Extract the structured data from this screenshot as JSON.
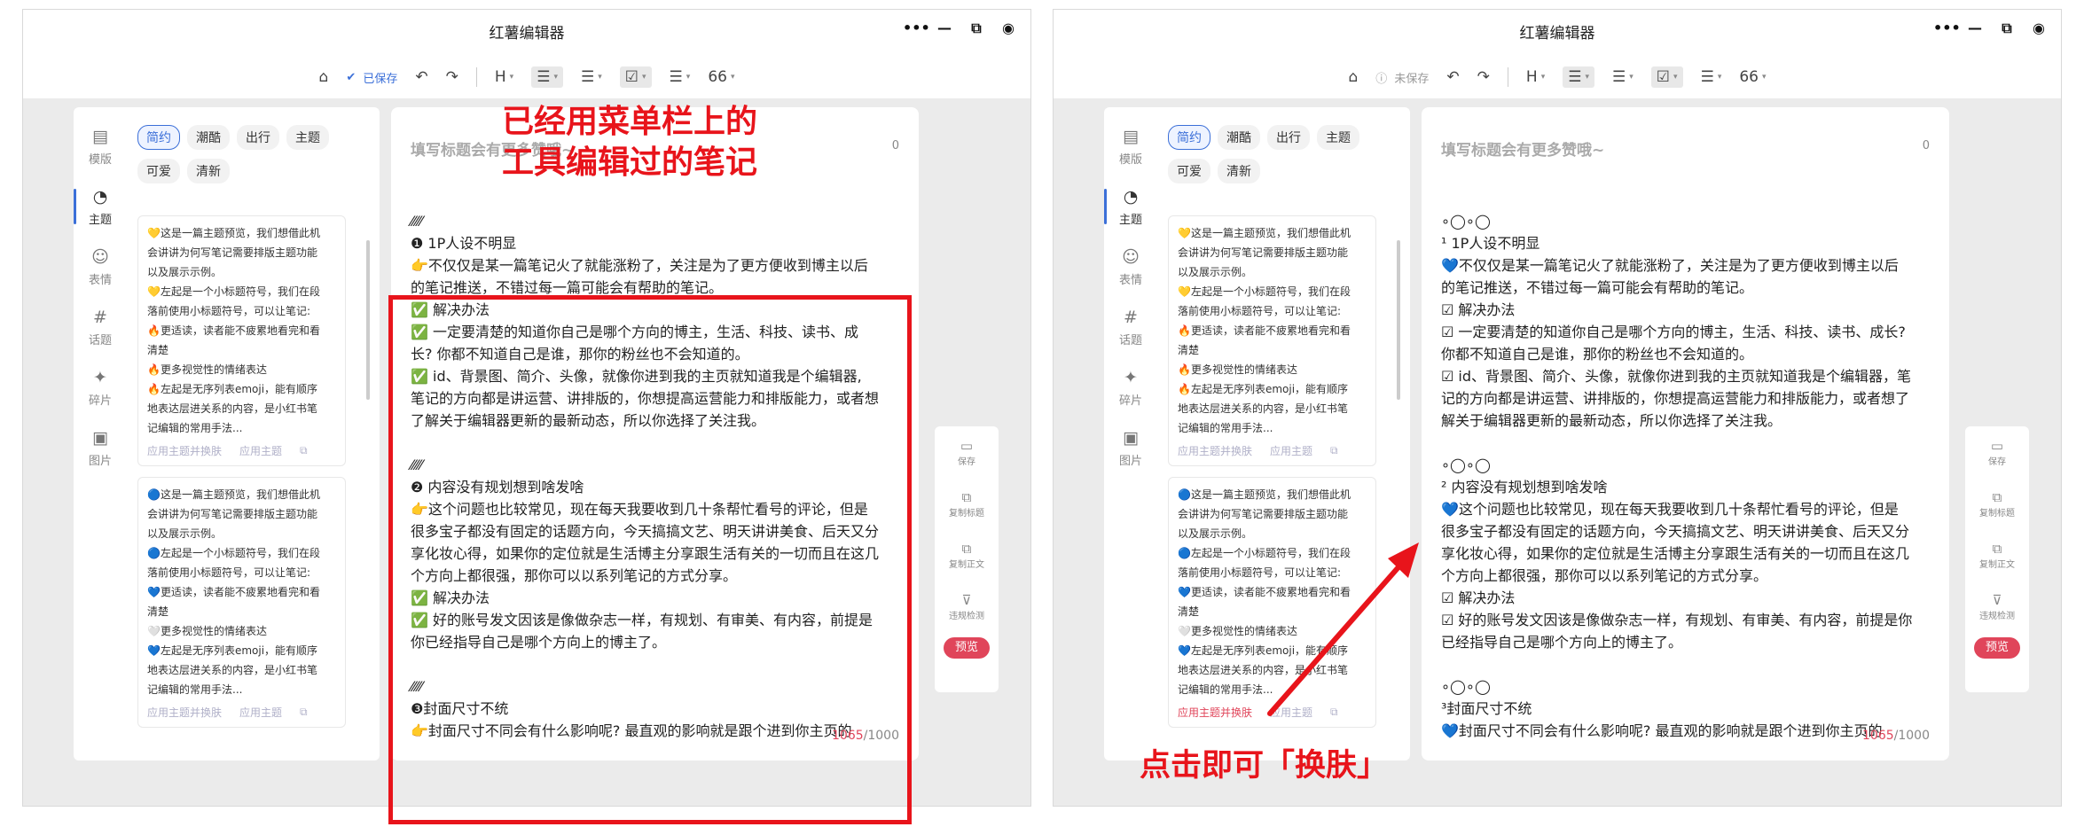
{
  "app": {
    "title": "红薯编辑器"
  },
  "toolbar": {
    "saved_label": "已保存",
    "unsaved_label": "未保存",
    "heading": "H",
    "list_ordered": "☰",
    "list_bullet": "☰",
    "checkbox": "☑",
    "align": "☰",
    "quote": "66"
  },
  "rail": [
    {
      "label": "模版",
      "icon": "template-icon"
    },
    {
      "label": "主题",
      "icon": "palette-icon"
    },
    {
      "label": "表情",
      "icon": "emoji-icon"
    },
    {
      "label": "话题",
      "icon": "hashtag-icon"
    },
    {
      "label": "碎片",
      "icon": "puzzle-icon"
    },
    {
      "label": "图片",
      "icon": "image-icon"
    }
  ],
  "theme_tags": [
    "简约",
    "潮酷",
    "出行",
    "主题",
    "可爱",
    "清新"
  ],
  "theme_cards": [
    {
      "lines": [
        "💛这是一篇主题预览，我们想借此机",
        "会讲讲为何写笔记需要排版主题功能",
        "以及展示示例。",
        "💛左起是一个小标题符号，我们在段",
        "落前使用小标题符号，可以让笔记:",
        "🔥更适读，读者能不疲累地看完和看",
        "清楚",
        "🔥更多视觉性的情绪表达",
        "🔥左起是无序列表emoji，能有顺序",
        "地表达层进关系的内容，是小红书笔",
        "记编辑的常用手法..."
      ],
      "apply_label": "应用主题并换肤",
      "theme_label": "应用主题"
    },
    {
      "lines": [
        "🔵这是一篇主题预览，我们想借此机",
        "会讲讲为何写笔记需要排版主题功能",
        "以及展示示例。",
        "🔵左起是一个小标题符号，我们在段",
        "落前使用小标题符号，可以让笔记:",
        "💙更适读，读者能不疲累地看完和看",
        "清楚",
        "🤍更多视觉性的情绪表达",
        "💙左起是无序列表emoji，能有顺序",
        "地表达层进关系的内容，是小红书笔",
        "记编辑的常用手法..."
      ],
      "apply_label": "应用主题并换肤",
      "theme_label": "应用主题"
    }
  ],
  "editor": {
    "title_placeholder": "填写标题会有更多赞哦~",
    "title_count": "0",
    "count_current": "1065",
    "count_max": "/1000"
  },
  "left_note": {
    "sections": [
      {
        "marker": "⁄⁄⁄⁄⁄",
        "lines": [
          "❶ 1P人设不明显",
          "👉不仅仅是某一篇笔记火了就能涨粉了，关注是为了更方便收到博主以后",
          "的笔记推送，不错过每一篇可能会有帮助的笔记。",
          "✅ 解决办法",
          "✅ 一定要清楚的知道你自己是哪个方向的博主，生活、科技、读书、成",
          "长? 你都不知道自己是谁，那你的粉丝也不会知道的。",
          "✅ id、背景图、简介、头像，就像你进到我的主页就知道我是个编辑器,",
          "笔记的方向都是讲运营、讲排版的，你想提高运营能力和排版能力，或者想",
          "了解关于编辑器更新的最新动态，所以你选择了关注我。"
        ]
      },
      {
        "marker": "⁄⁄⁄⁄⁄",
        "lines": [
          "❷ 内容没有规划想到啥发啥",
          "👉这个问题也比较常见，现在每天我要收到几十条帮忙看号的评论，但是",
          "很多宝子都没有固定的话题方向，今天搞搞文艺、明天讲讲美食、后天又分",
          "享化妆心得，如果你的定位就是生活博主分享跟生活有关的一切而且在这几",
          "个方向上都很强，那你可以以系列笔记的方式分享。",
          "✅ 解决办法",
          "✅ 好的账号发文因该是像做杂志一样，有规划、有审美、有内容，前提是",
          "你已经指导自己是哪个方向上的博主了。"
        ]
      },
      {
        "marker": "⁄⁄⁄⁄⁄",
        "lines": [
          "❸封面尺寸不统",
          "👉封面尺寸不同会有什么影响呢? 最直观的影响就是跟个进到你主页的"
        ]
      }
    ]
  },
  "right_note": {
    "sections": [
      {
        "marker": "∘◯∘◯",
        "lines": [
          "¹ 1P人设不明显",
          "💙不仅仅是某一篇笔记火了就能涨粉了，关注是为了更方便收到博主以后",
          "的笔记推送，不错过每一篇可能会有帮助的笔记。",
          "☑ 解决办法",
          "☑ 一定要清楚的知道你自己是哪个方向的博主，生活、科技、读书、成长?",
          "你都不知道自己是谁，那你的粉丝也不会知道的。",
          "☑ id、背景图、简介、头像，就像你进到我的主页就知道我是个编辑器，笔",
          "记的方向都是讲运营、讲排版的，你想提高运营能力和排版能力，或者想了",
          "解关于编辑器更新的最新动态，所以你选择了关注我。"
        ]
      },
      {
        "marker": "∘◯∘◯",
        "lines": [
          "² 内容没有规划想到啥发啥",
          "💙这个问题也比较常见，现在每天我要收到几十条帮忙看号的评论，但是",
          "很多宝子都没有固定的话题方向，今天搞搞文艺、明天讲讲美食、后天又分",
          "享化妆心得，如果你的定位就是生活博主分享跟生活有关的一切而且在这几",
          "个方向上都很强，那你可以以系列笔记的方式分享。",
          "☑ 解决办法",
          "☑ 好的账号发文因该是像做杂志一样，有规划、有审美、有内容，前提是你",
          "已经指导自己是哪个方向上的博主了。"
        ]
      },
      {
        "marker": "∘◯∘◯",
        "lines": [
          "³封面尺寸不统",
          "💙封面尺寸不同会有什么影响呢? 最直观的影响就是跟个进到你主页的"
        ]
      }
    ]
  },
  "side_panel": [
    {
      "label": "保存",
      "icon": "save-icon"
    },
    {
      "label": "复制标题",
      "icon": "copy-title-icon"
    },
    {
      "label": "复制正文",
      "icon": "copy-body-icon"
    },
    {
      "label": "违规检测",
      "icon": "filter-check-icon"
    }
  ],
  "preview_label": "预览",
  "annotations": {
    "left_line1": "已经用菜单栏上的",
    "left_line2": "工具编辑过的笔记",
    "right": "点击即可「换肤」"
  },
  "colors": {
    "accent": "#3b6fd8",
    "brand_red": "#e0455a",
    "annotation_red": "#e8141b",
    "workspace_bg": "#ebebeb"
  }
}
